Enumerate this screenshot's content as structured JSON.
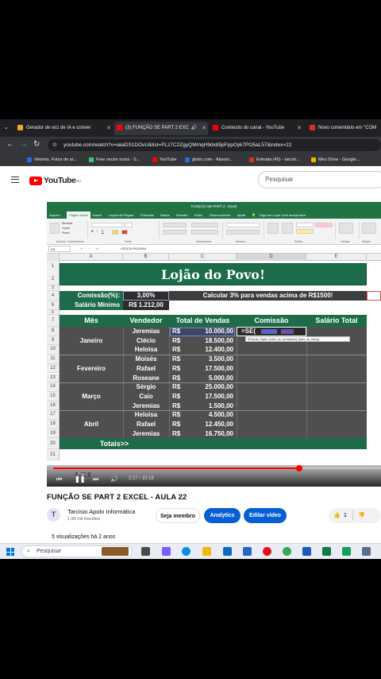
{
  "browser": {
    "tabs": [
      {
        "label": "Gerador de voz de IA e conver",
        "color": "#f5a623",
        "active": false
      },
      {
        "label": "(3) FUNÇÃO SE PART 2 EXC",
        "color": "#ff0000",
        "active": true
      },
      {
        "label": "Conteúdo do canal - YouTube",
        "color": "#ff0000",
        "active": false
      },
      {
        "label": "Novo comentário em \"COM",
        "color": "#d93025",
        "active": false
      }
    ],
    "url": "youtube.com/watch?v=iaiaDS1DOvU&list=PLz7C2ZgyQMmqH9dx85pFppOyk7PO5aL57&index=22",
    "bookmarks": [
      {
        "label": "Vetores, Fotos de ar...",
        "color": "#1a73e8"
      },
      {
        "label": "Free vector icons - S...",
        "color": "#2ecc71"
      },
      {
        "label": "YouTube",
        "color": "#ff0000"
      },
      {
        "label": "globo.com - Absolu...",
        "color": "#1a73e8"
      },
      {
        "label": "Entrada (45) - tarcisi...",
        "color": "#d93025"
      },
      {
        "label": "Meu Drive - Google...",
        "color": "#f4b400"
      }
    ]
  },
  "youtube": {
    "logo_text": "YouTube",
    "logo_sup": "BR",
    "search_placeholder": "Pesquisar",
    "video_title": "FUNÇÃO SE PART 2 EXCEL - AULA 22",
    "channel_name": "Tarcisio Apolo Informática",
    "channel_avatar": "T",
    "subscribers": "1,95 mil inscritos",
    "member_label": "Seja membro",
    "analytics_label": "Analytics",
    "edit_label": "Editar vídeo",
    "like_count": "1",
    "views_text": "5 visualizações  há 2 anos",
    "time_text": "2:27 / 15:18",
    "progress": 0.75,
    "colors": {
      "accent": "#065fd4",
      "red": "#ff0000"
    }
  },
  "excel": {
    "window_title": "FUNÇÃO SE PART 2  -  Excel",
    "menu": [
      "Arquivo",
      "Página Inicial",
      "Inserir",
      "Layout da Página",
      "Fórmulas",
      "Dados",
      "Revisão",
      "Exibir",
      "Desenvolvedor",
      "Ajuda",
      "Diga-me o que você deseja fazer"
    ],
    "ribbon_groups": [
      "Área de Transferência",
      "Fonte",
      "Alinhamento",
      "Número",
      "Estilos",
      "Células",
      "Edição"
    ],
    "ribbon_items": [
      "Recortar",
      "Copiar",
      "Pincel"
    ],
    "name_box": "D8",
    "formula": "=SE(C8>PAC8*B4",
    "columns": [
      "A",
      "B",
      "C",
      "D",
      "E"
    ],
    "title": "Lojão do Povo!",
    "commission_label": "Comissão(%):",
    "commission_value": "3,00%",
    "note": "Calcular 3% para vendas acima de R$1500!",
    "min_salary_label": "Salário Mínimo",
    "min_salary_value": "R$  1.212,00",
    "headers": [
      "Mês",
      "Vendedor",
      "Total de Vendas",
      "Comissão",
      "Salário Total"
    ],
    "months": [
      "Janeiro",
      "Fevereiro",
      "Março",
      "Abril"
    ],
    "rows": [
      {
        "seller": "Jeremias",
        "cur": "R$",
        "amount": "10.000,00"
      },
      {
        "seller": "Clécio",
        "cur": "R$",
        "amount": "18.500,00"
      },
      {
        "seller": "Heloisa",
        "cur": "R$",
        "amount": "12.400,00"
      },
      {
        "seller": "Moisés",
        "cur": "R$",
        "amount": "3.500,00"
      },
      {
        "seller": "Rafael",
        "cur": "R$",
        "amount": "17.500,00"
      },
      {
        "seller": "Roseane",
        "cur": "R$",
        "amount": "5.000,00"
      },
      {
        "seller": "Sérgio",
        "cur": "R$",
        "amount": "25.000,00"
      },
      {
        "seller": "Caio",
        "cur": "R$",
        "amount": "17.500,00"
      },
      {
        "seller": "Jeremias",
        "cur": "R$",
        "amount": "1.500,00"
      },
      {
        "seller": "Heloisa",
        "cur": "R$",
        "amount": "4.500,00"
      },
      {
        "seller": "Rafael",
        "cur": "R$",
        "amount": "12.450,00"
      },
      {
        "seller": "Jeremias",
        "cur": "R$",
        "amount": "16.750,00"
      }
    ],
    "editing_text": "=SE(",
    "tooltip": "SE(teste_lógico; [valor_se_verdadeiro]; [valor_se_falso])",
    "totals_label": "Totais>>",
    "row_numbers": [
      "1",
      "2",
      "3",
      "4",
      "5",
      "6",
      "7",
      "8",
      "9",
      "10",
      "11",
      "12",
      "13",
      "14",
      "15",
      "16",
      "17",
      "18",
      "19",
      "20",
      "21"
    ],
    "sheet_tab": "Plan1"
  },
  "taskbar": {
    "search_placeholder": "Pesquisar",
    "apps": [
      {
        "name": "task-view",
        "color": "#4a4a4a"
      },
      {
        "name": "copilot",
        "color": "#7b5cff"
      },
      {
        "name": "edge",
        "color": "#0c8ce9"
      },
      {
        "name": "explorer",
        "color": "#f2b90c"
      },
      {
        "name": "mail",
        "color": "#0f6cbd"
      },
      {
        "name": "security",
        "color": "#2a62c9"
      },
      {
        "name": "opera",
        "color": "#e0121c"
      },
      {
        "name": "chrome",
        "color": "#34a853"
      },
      {
        "name": "word",
        "color": "#185abd"
      },
      {
        "name": "excel",
        "color": "#107c41"
      },
      {
        "name": "camtasia",
        "color": "#14a05a"
      },
      {
        "name": "photos",
        "color": "#5a6b8c"
      }
    ]
  }
}
